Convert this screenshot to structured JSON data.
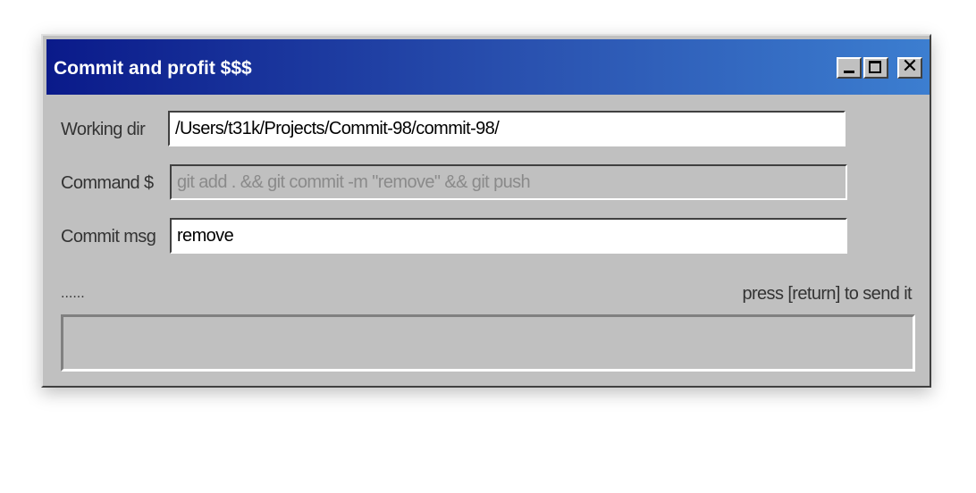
{
  "window": {
    "title": "Commit and profit $$$",
    "controls": {
      "minimize_icon": "minimize-icon",
      "maximize_icon": "maximize-icon",
      "close_icon": "close-icon"
    }
  },
  "form": {
    "working_dir": {
      "label": "Working dir",
      "value": "/Users/t31k/Projects/Commit-98/commit-98/"
    },
    "command": {
      "label": "Command $",
      "value": "git add . && git commit -m \"remove\" && git push"
    },
    "commit_msg": {
      "label": "Commit msg",
      "value": "remove"
    }
  },
  "status": {
    "indicator": "......",
    "hint": "press [return] to send it",
    "output": ""
  },
  "colors": {
    "titlebar_start": "#0a1a8a",
    "titlebar_end": "#3c7ed0",
    "window_bg": "#c0c0c0"
  }
}
